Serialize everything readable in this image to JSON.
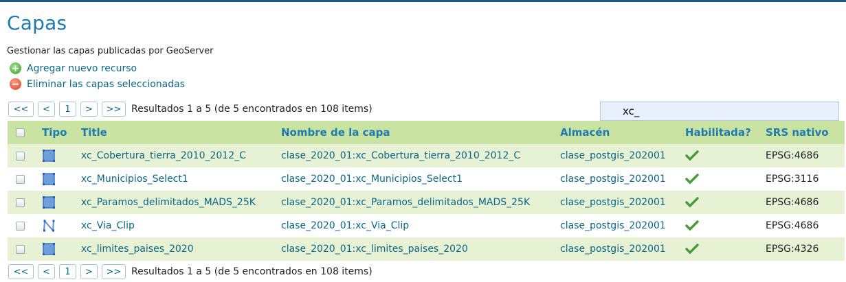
{
  "page": {
    "title": "Capas",
    "subtitle": "Gestionar las capas publicadas por GeoServer"
  },
  "actions": {
    "add_label": "Agregar nuevo recurso",
    "remove_label": "Eliminar las capas seleccionadas"
  },
  "pager": {
    "first": "<<",
    "prev": "<",
    "current": "1",
    "next": ">",
    "last": ">>",
    "info": "Resultados 1 a 5 (de 5 encontrados en 108 items)"
  },
  "search": {
    "value": "xc_"
  },
  "table": {
    "headers": {
      "type": "Tipo",
      "title": "Title",
      "name": "Nombre de la capa",
      "store": "Almacén",
      "enabled": "Habilitada?",
      "srs": "SRS nativo"
    },
    "rows": [
      {
        "type_icon": "polygon-layer-icon",
        "title": "xc_Cobertura_tierra_2010_2012_C",
        "name": "clase_2020_01:xc_Cobertura_tierra_2010_2012_C",
        "store": "clase_postgis_202001",
        "enabled": true,
        "srs": "EPSG:4686"
      },
      {
        "type_icon": "polygon-layer-icon",
        "title": "xc_Municipios_Select1",
        "name": "clase_2020_01:xc_Municipios_Select1",
        "store": "clase_postgis_202001",
        "enabled": true,
        "srs": "EPSG:3116"
      },
      {
        "type_icon": "polygon-layer-icon",
        "title": "xc_Paramos_delimitados_MADS_25K",
        "name": "clase_2020_01:xc_Paramos_delimitados_MADS_25K",
        "store": "clase_postgis_202001",
        "enabled": true,
        "srs": "EPSG:4686"
      },
      {
        "type_icon": "line-layer-icon",
        "title": "xc_Via_Clip",
        "name": "clase_2020_01:xc_Via_Clip",
        "store": "clase_postgis_202001",
        "enabled": true,
        "srs": "EPSG:4686"
      },
      {
        "type_icon": "polygon-layer-icon",
        "title": "xc_limites_paises_2020",
        "name": "clase_2020_01:xc_limites_paises_2020",
        "store": "clase_postgis_202001",
        "enabled": true,
        "srs": "EPSG:4326"
      }
    ]
  },
  "colors": {
    "title": "#1e7bb0",
    "link": "#0b6688",
    "header_bg": "#c9e3a2",
    "row_alt_bg": "#e6f2d3",
    "check": "#4a9a3a"
  }
}
